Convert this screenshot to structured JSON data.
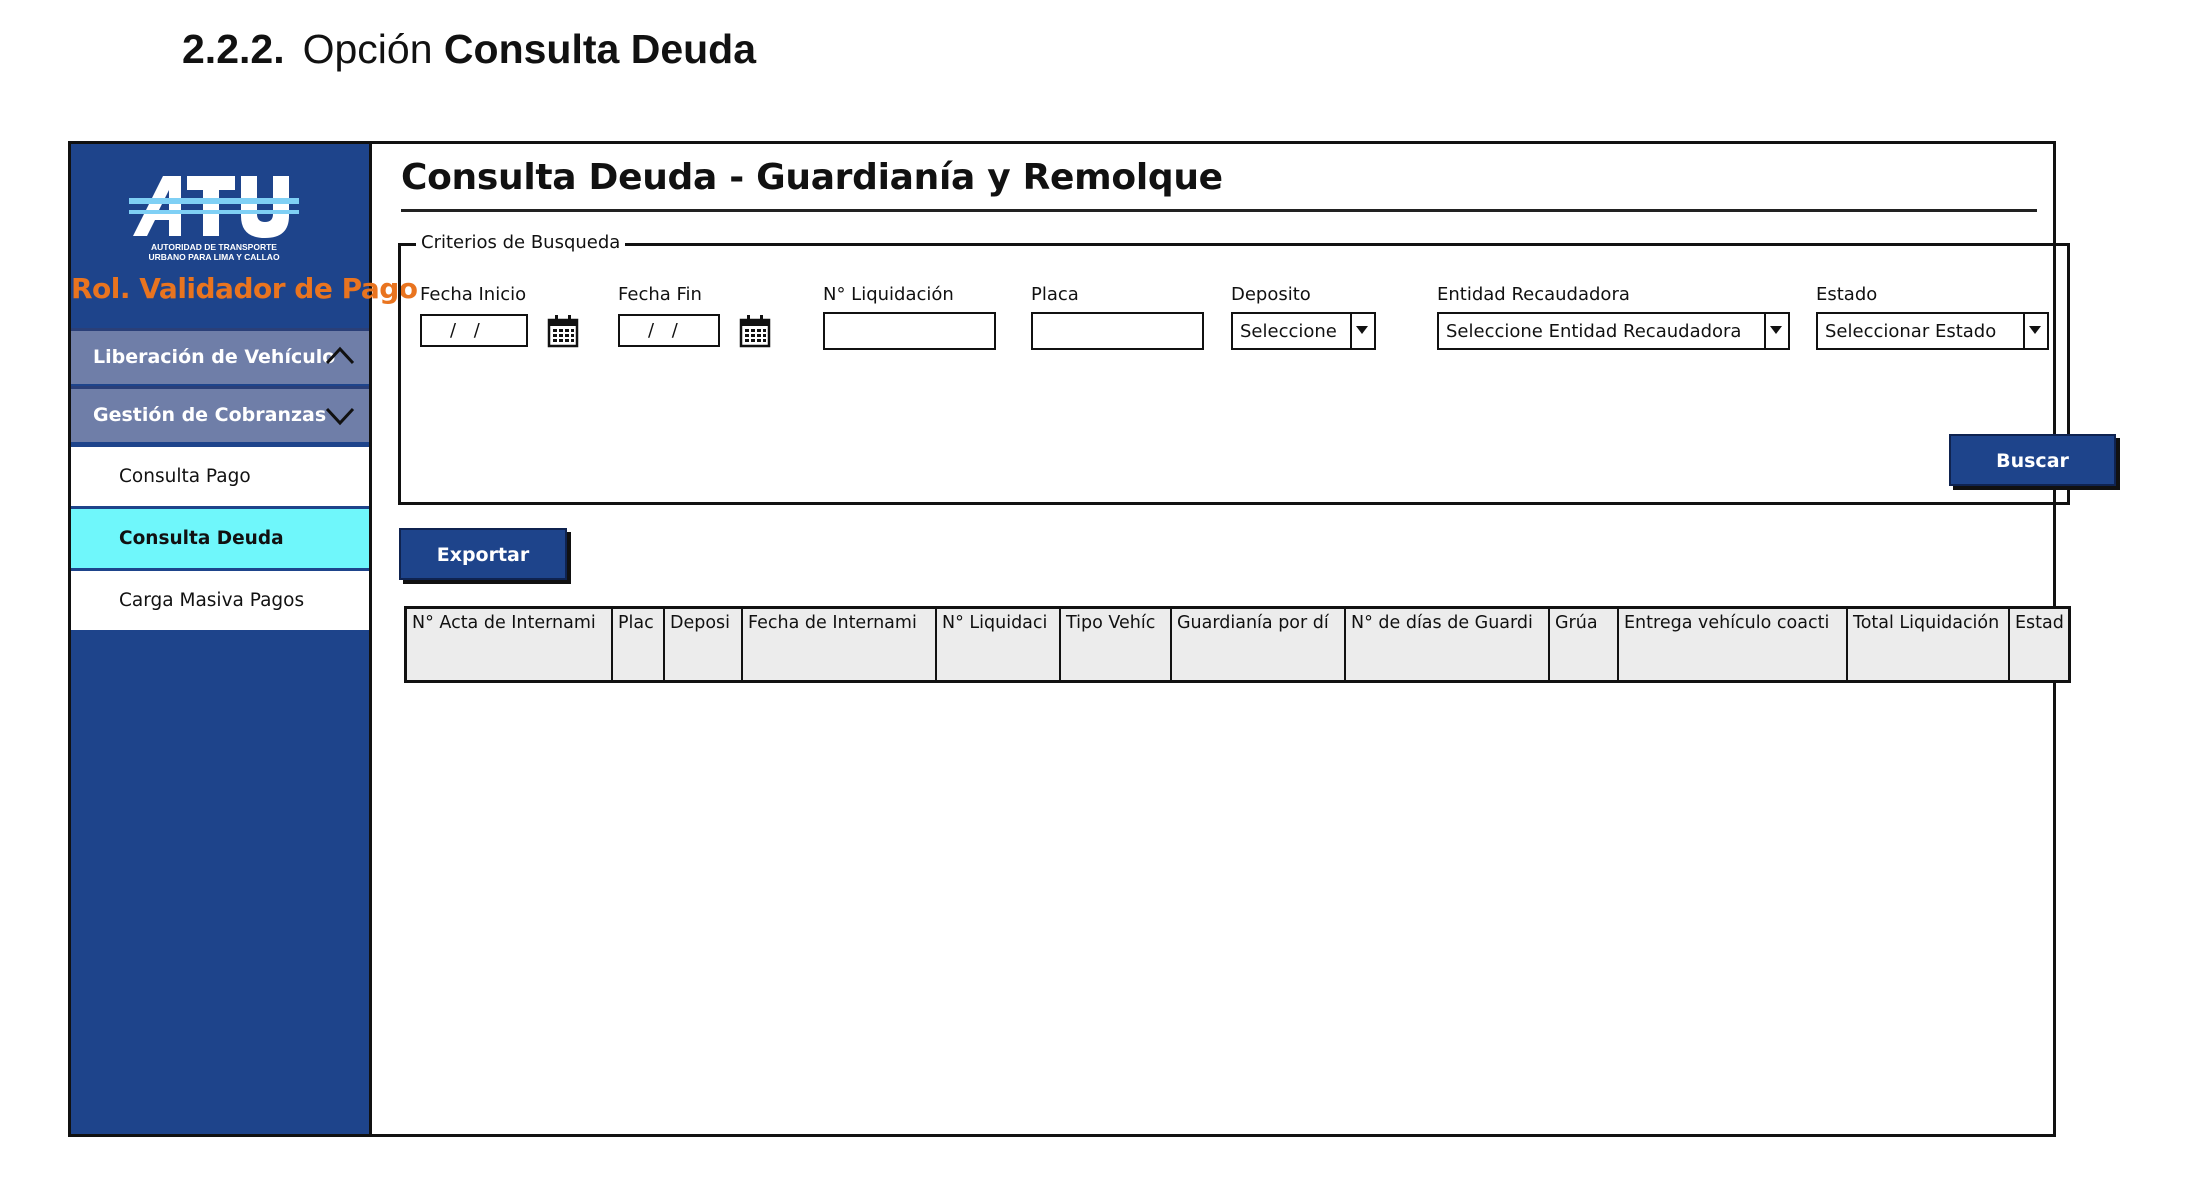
{
  "doc_heading": {
    "number": "2.2.2.",
    "prefix": "Opción",
    "emphasis": "Consulta Deuda"
  },
  "sidebar": {
    "logo": {
      "name": "ATU",
      "subtitle": "AUTORIDAD DE TRANSPORTE URBANO PARA LIMA Y CALLAO"
    },
    "role_title": "Rol. Validador de Pago",
    "groups": [
      {
        "label": "Liberación de Vehículo",
        "expanded": false
      },
      {
        "label": "Gestión de Cobranzas",
        "expanded": true
      }
    ],
    "items": [
      {
        "label": "Consulta Pago"
      },
      {
        "label": "Consulta Deuda",
        "active": true
      },
      {
        "label": "Carga Masiva Pagos"
      }
    ]
  },
  "main": {
    "title": "Consulta Deuda - Guardianía y Remolque",
    "criteria": {
      "legend": "Criterios de Busqueda",
      "fecha_inicio": {
        "label": "Fecha Inicio",
        "value": "/ /"
      },
      "fecha_fin": {
        "label": "Fecha Fin",
        "value": "/ /"
      },
      "liquidacion": {
        "label": "N° Liquidación",
        "value": ""
      },
      "placa": {
        "label": "Placa",
        "value": ""
      },
      "deposito": {
        "label": "Deposito",
        "value": "Seleccione"
      },
      "entidad": {
        "label": "Entidad Recaudadora",
        "value": "Seleccione Entidad Recaudadora"
      },
      "estado": {
        "label": "Estado",
        "value": "Seleccionar Estado"
      },
      "search_button": "Buscar"
    },
    "export_button": "Exportar",
    "table": {
      "columns": [
        "N° Acta de Internami",
        "Plac",
        "Deposi",
        "Fecha de Internami",
        "N° Liquidaci",
        "Tipo Vehíc",
        "Guardianía por dí",
        "N° de días de Guardi",
        "Grúa",
        "Entrega vehículo coacti",
        "Total Liquidación",
        "Estad"
      ],
      "rows": []
    }
  },
  "colors": {
    "sidebar": "#1e448b",
    "sidebar_group": "#6f7ea8",
    "active_item": "#6ff7fb",
    "role_title": "#e9741f",
    "button": "#1e448b"
  }
}
